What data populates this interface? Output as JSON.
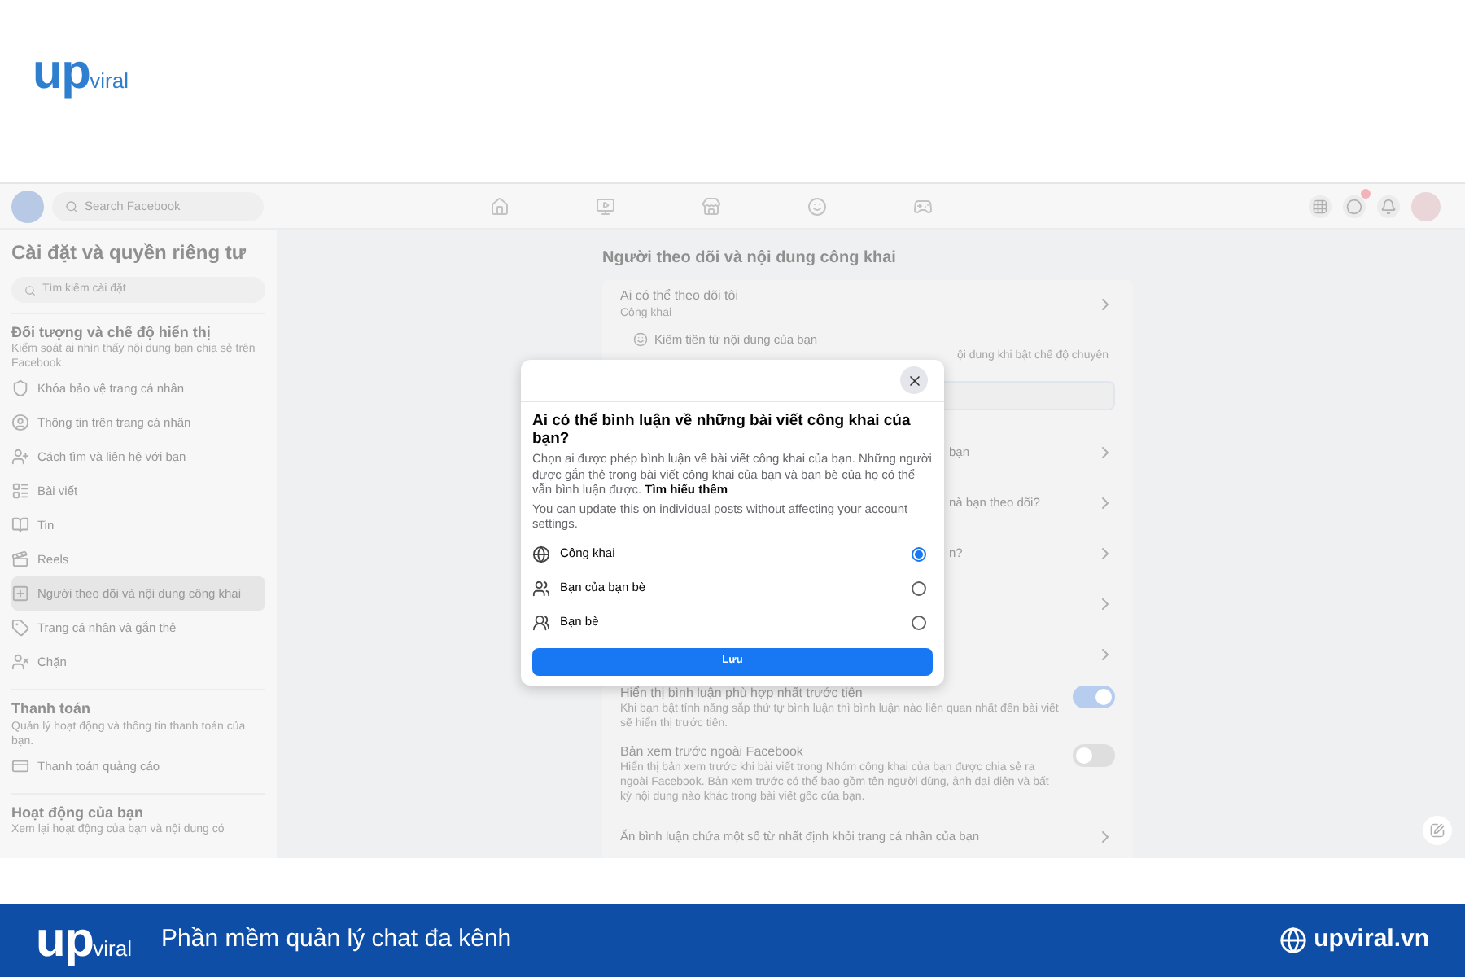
{
  "brand": {
    "logo_main": "up",
    "logo_sub": "viral"
  },
  "topbar": {
    "search_placeholder": "Search Facebook",
    "nav": [
      {
        "kind": "home",
        "selected": false
      },
      {
        "kind": "video",
        "selected": false
      },
      {
        "kind": "market",
        "selected": false
      },
      {
        "kind": "groups",
        "selected": false
      },
      {
        "kind": "gaming",
        "selected": false
      }
    ]
  },
  "sidebar": {
    "title": "Cài đặt và quyền riêng tư",
    "search_placeholder": "Tìm kiếm cài đặt",
    "sections": [
      {
        "heading": "Đối tượng và chế độ hiển thị",
        "description": "Kiểm soát ai nhìn thấy nội dung bạn chia sẻ trên Facebook.",
        "items": [
          {
            "label": "Khóa bảo vệ trang cá nhân",
            "kind": "shield",
            "selected": false
          },
          {
            "label": "Thông tin trên trang cá nhân",
            "kind": "profile",
            "selected": false
          },
          {
            "label": "Cách tìm và liên hệ với bạn",
            "kind": "person-add",
            "selected": false
          },
          {
            "label": "Bài viết",
            "kind": "posts",
            "selected": false
          },
          {
            "label": "Tin",
            "kind": "stories",
            "selected": false
          },
          {
            "label": "Reels",
            "kind": "reels",
            "selected": false
          },
          {
            "label": "Người theo dõi và nội dung công khai",
            "kind": "followers",
            "selected": true
          },
          {
            "label": "Trang cá nhân và gắn thẻ",
            "kind": "tag",
            "selected": false
          },
          {
            "label": "Chặn",
            "kind": "block",
            "selected": false
          }
        ]
      },
      {
        "heading": "Thanh toán",
        "description": "Quản lý hoạt động và thông tin thanh toán của bạn.",
        "items": [
          {
            "label": "Thanh toán quảng cáo",
            "kind": "card",
            "selected": false
          }
        ]
      },
      {
        "heading": "Hoạt động của bạn",
        "description": "Xem lại hoạt động của bạn và nội dung có"
      }
    ]
  },
  "main": {
    "title": "Người theo dõi và nội dung công khai",
    "follow": {
      "label": "Ai có thể theo dõi tôi",
      "value": "Công khai",
      "sub_label": "Kiếm tiền từ nội dung của bạn",
      "sub_fragment": "ội dung khi bật chế độ chuyên"
    },
    "rows": [
      {
        "kind": "link",
        "fragment": "bạn"
      },
      {
        "kind": "link",
        "fragment": "nà bạn theo dõi?"
      },
      {
        "kind": "link",
        "fragment": "n?"
      },
      {
        "kind": "link"
      },
      {
        "kind": "link"
      },
      {
        "kind": "toggle",
        "label": "Hiển thị bình luận phù hợp nhất trước tiên",
        "description": "Khi bạn bật tính năng sắp thứ tự bình luận thì bình luận nào liên quan nhất đến bài viết sẽ hiển thị trước tiên.",
        "on": true
      },
      {
        "kind": "toggle",
        "label": "Bản xem trước ngoài Facebook",
        "description": "Hiển thị bản xem trước khi bài viết trong Nhóm công khai của bạn được chia sẻ ra ngoài Facebook. Bản xem trước có thể bao gồm tên người dùng, ảnh đại diện và bất kỳ nội dung nào khác trong bài viết gốc của bạn.",
        "on": false
      },
      {
        "kind": "link",
        "label": "Ẩn bình luận chứa một số từ nhất định khỏi trang cá nhân của bạn"
      }
    ]
  },
  "dialog": {
    "title": "Ai có thể bình luận về những bài viết công khai của bạn?",
    "description": "Chọn ai được phép bình luận về bài viết công khai của bạn. Những người được gắn thẻ trong bài viết công khai của bạn và bạn bè của họ có thể vẫn bình luận được.",
    "link": "Tìm hiểu thêm",
    "note": "You can update this on individual posts without affecting your account settings.",
    "options": [
      {
        "label": "Công khai",
        "kind": "public",
        "selected": true
      },
      {
        "label": "Bạn của bạn bè",
        "kind": "friends-of-friends",
        "selected": false
      },
      {
        "label": "Bạn bè",
        "kind": "friends",
        "selected": false
      }
    ],
    "save": "Lưu"
  },
  "banner": {
    "logo_main": "up",
    "logo_sub": "viral",
    "tagline": "Phần mềm quản lý chat đa kênh",
    "website": "upviral.vn"
  }
}
